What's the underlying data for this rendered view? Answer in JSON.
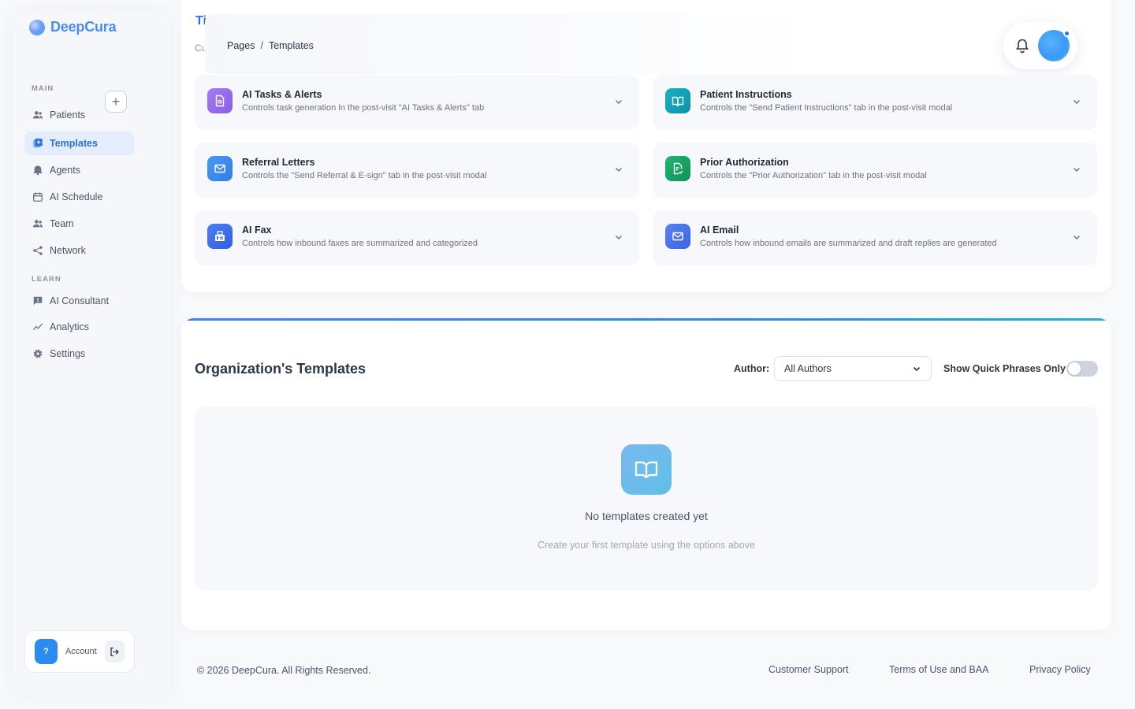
{
  "brand": {
    "name": "DeepCura"
  },
  "sidebar": {
    "main_label": "MAIN",
    "learn_label": "LEARN",
    "items": [
      {
        "label": "Patients",
        "icon": "users-icon"
      },
      {
        "label": "Templates",
        "icon": "templates-icon",
        "active": true
      },
      {
        "label": "Agents",
        "icon": "agent-bell-icon"
      },
      {
        "label": "AI Schedule",
        "icon": "calendar-icon"
      },
      {
        "label": "Team",
        "icon": "team-icon"
      },
      {
        "label": "Network",
        "icon": "share-icon"
      },
      {
        "label": "AI Consultant",
        "icon": "chat-alert-icon"
      },
      {
        "label": "Analytics",
        "icon": "trend-icon"
      },
      {
        "label": "Settings",
        "icon": "gear-icon"
      }
    ],
    "add_button": "+",
    "account": {
      "help": "?",
      "label": "Account"
    }
  },
  "header": {
    "partial_title": "Ti",
    "partial_subtitle": "Cu",
    "breadcrumb": {
      "parent": "Pages",
      "separator": "/",
      "current": "Templates"
    }
  },
  "settings_cards": [
    {
      "title": "AI Tasks & Alerts",
      "desc": "Controls task generation in the post-visit \"AI Tasks & Alerts\" tab",
      "color": "#9b6cf0"
    },
    {
      "title": "Patient Instructions",
      "desc": "Controls the \"Send Patient Instructions\" tab in the post-visit modal",
      "color": "#13a3b8"
    },
    {
      "title": "Referral Letters",
      "desc": "Controls the \"Send Referral & E-sign\" tab in the post-visit modal",
      "color": "#3d8bf0"
    },
    {
      "title": "Prior Authorization",
      "desc": "Controls the \"Prior Authorization\" tab in the post-visit modal",
      "color": "#18a86a"
    },
    {
      "title": "AI Fax",
      "desc": "Controls how inbound faxes are summarized and categorized",
      "color": "#3d6ef0"
    },
    {
      "title": "AI Email",
      "desc": "Controls how inbound emails are summarized and draft replies are generated",
      "color": "#4a72ee"
    }
  ],
  "templates": {
    "title": "Organization's Templates",
    "author_label": "Author:",
    "author_value": "All Authors",
    "quick_phrases_label": "Show Quick Phrases Only",
    "quick_phrases_on": false,
    "empty_title": "No templates created yet",
    "empty_subtitle": "Create your first template using the options above"
  },
  "footer": {
    "copyright": "© 2026 DeepCura. All Rights Reserved.",
    "links": [
      "Customer Support",
      "Terms of Use and BAA",
      "Privacy Policy"
    ]
  },
  "colors": {
    "accent": "#2f6fe0",
    "primary_button": "#2a8cf0"
  }
}
